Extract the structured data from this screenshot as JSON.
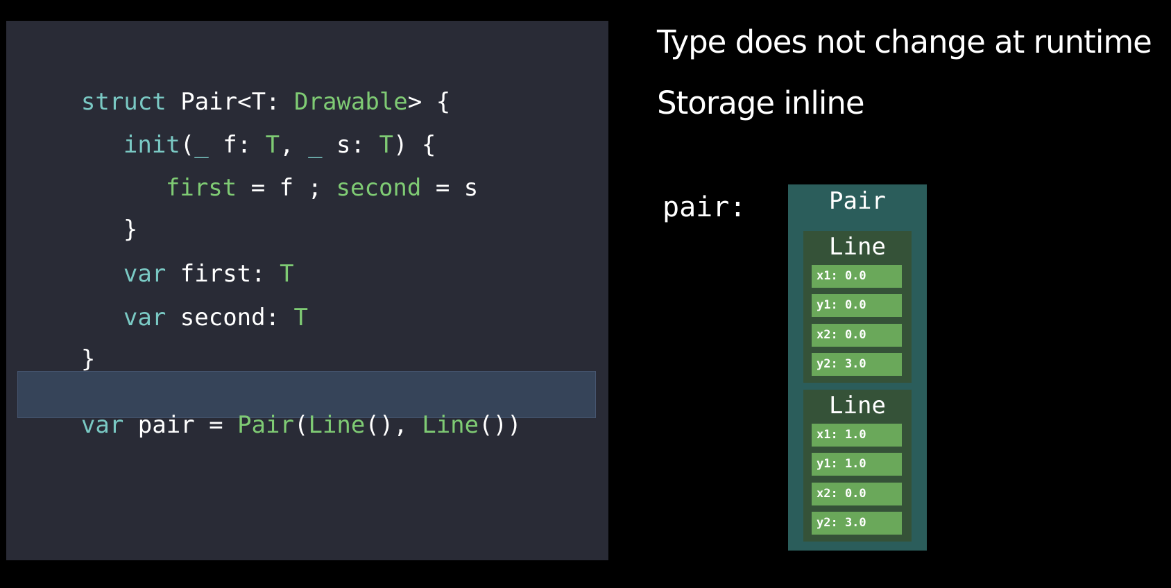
{
  "code": {
    "lines": [
      [
        "struct",
        " ",
        "Pair",
        "<",
        "T",
        ": ",
        "Drawable",
        "> {"
      ],
      [
        "init",
        "(",
        "_",
        " f: ",
        "T",
        ", ",
        "_",
        " s: ",
        "T",
        ") {"
      ],
      [
        "first",
        " = f ; ",
        "second",
        " = s"
      ],
      [
        "}"
      ],
      [
        "var",
        " first: ",
        "T"
      ],
      [
        "var",
        " second: ",
        "T"
      ],
      [
        "}"
      ]
    ],
    "statement": [
      "var",
      " pair = ",
      "Pair",
      "(",
      "Line",
      "(), ",
      "Line",
      "())"
    ]
  },
  "headings": [
    "Type does not change at runtime",
    "Storage inline"
  ],
  "diagram": {
    "variable_label": "pair:",
    "pair_title": "Pair",
    "lines": [
      {
        "title": "Line",
        "fields": [
          "x1: 0.0",
          "y1: 0.0",
          "x2: 0.0",
          "y2: 3.0"
        ]
      },
      {
        "title": "Line",
        "fields": [
          "x1: 1.0",
          "y1: 1.0",
          "x2: 0.0",
          "y2: 3.0"
        ]
      }
    ]
  },
  "colors": {
    "background": "#000000",
    "code_background": "#292b36",
    "keyword": "#7ac9c4",
    "type": "#7fcb74",
    "highlight": "#364459",
    "pair_box": "#2b5d5b",
    "line_box": "#355238",
    "field": "#6aa85a"
  }
}
